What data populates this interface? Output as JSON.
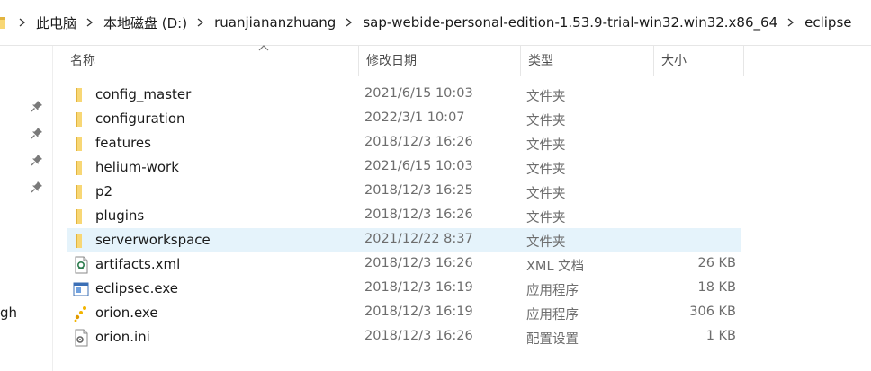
{
  "breadcrumb": {
    "items": [
      "此电脑",
      "本地磁盘 (D:)",
      "ruanjiananzhuang",
      "sap-webide-personal-edition-1.53.9-trial-win32.win32.x86_64",
      "eclipse"
    ]
  },
  "nav": {
    "fragment_text": "gh"
  },
  "columns": {
    "name": "名称",
    "modified": "修改日期",
    "type": "类型",
    "size": "大小"
  },
  "files": [
    {
      "name": "config_master",
      "modified": "2021/6/15 10:03",
      "type": "文件夹",
      "size": "",
      "icon": "folder-icon"
    },
    {
      "name": "configuration",
      "modified": "2022/3/1 10:07",
      "type": "文件夹",
      "size": "",
      "icon": "folder-icon"
    },
    {
      "name": "features",
      "modified": "2018/12/3 16:26",
      "type": "文件夹",
      "size": "",
      "icon": "folder-icon"
    },
    {
      "name": "helium-work",
      "modified": "2021/6/15 10:03",
      "type": "文件夹",
      "size": "",
      "icon": "folder-icon"
    },
    {
      "name": "p2",
      "modified": "2018/12/3 16:25",
      "type": "文件夹",
      "size": "",
      "icon": "folder-icon"
    },
    {
      "name": "plugins",
      "modified": "2018/12/3 16:26",
      "type": "文件夹",
      "size": "",
      "icon": "folder-icon"
    },
    {
      "name": "serverworkspace",
      "modified": "2021/12/22 8:37",
      "type": "文件夹",
      "size": "",
      "icon": "folder-icon",
      "selected": true
    },
    {
      "name": "artifacts.xml",
      "modified": "2018/12/3 16:26",
      "type": "XML 文档",
      "size": "26 KB",
      "icon": "xml-file-icon"
    },
    {
      "name": "eclipsec.exe",
      "modified": "2018/12/3 16:19",
      "type": "应用程序",
      "size": "18 KB",
      "icon": "exe-window-icon"
    },
    {
      "name": "orion.exe",
      "modified": "2018/12/3 16:19",
      "type": "应用程序",
      "size": "306 KB",
      "icon": "orion-exe-icon"
    },
    {
      "name": "orion.ini",
      "modified": "2018/12/3 16:26",
      "type": "配置设置",
      "size": "1 KB",
      "icon": "ini-settings-icon"
    }
  ],
  "colors": {
    "folder": "#f8d775",
    "folder_dark": "#e2b43f",
    "selection": "#e5f3fb",
    "secondary_text": "#6d6d6d"
  }
}
